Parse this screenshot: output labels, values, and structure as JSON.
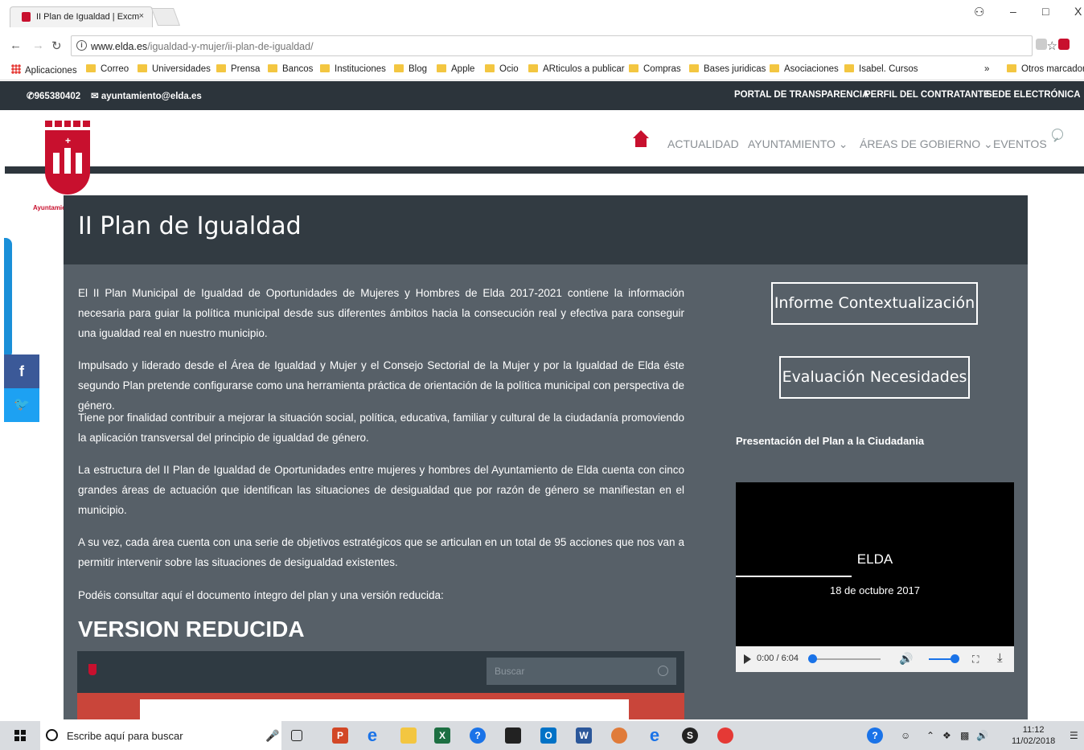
{
  "browser": {
    "tab_title": "II Plan de Igualdad | Excm",
    "tab_close": "×",
    "url_host": "www.elda.es",
    "url_path": "/igualdad-y-mujer/ii-plan-de-igualdad/",
    "window_minimize": "–",
    "window_maximize": "□",
    "window_close": "X"
  },
  "bookmarks": {
    "items": [
      "Aplicaciones",
      "Correo",
      "Universidades",
      "Prensa",
      "Bancos",
      "Instituciones",
      "Blog",
      "Apple",
      "Ocio",
      "ARticulos a publicar",
      "Compras",
      "Bases juridicas",
      "Asociaciones",
      "Isabel. Cursos"
    ],
    "overflow": "»",
    "other": "Otros marcadores"
  },
  "site_top": {
    "phone": "965380402",
    "email": "ayuntamiento@elda.es",
    "links": [
      "PORTAL DE TRANSPARENCIA",
      "PERFIL DEL CONTRATANTE",
      "SEDE ELECTRÓNICA"
    ]
  },
  "header": {
    "logo_text": "Ayuntamiento de Elda",
    "nav": [
      "ACTUALIDAD",
      "AYUNTAMIENTO ⌄",
      "ÁREAS DE GOBIERNO ⌄",
      "EVENTOS"
    ]
  },
  "page": {
    "title": "II Plan de Igualdad",
    "paragraphs": [
      "El II Plan Municipal de Igualdad de Oportunidades de Mujeres y Hombres de Elda 2017-2021 contiene la información necesaria para guiar la política municipal desde sus diferentes ámbitos hacia la consecución real y efectiva para conseguir una igualdad real en nuestro municipio.",
      "Impulsado y liderado desde el Área de Igualdad y Mujer y el Consejo Sectorial de la Mujer y por la Igualdad de Elda  éste segundo Plan pretende configurarse como una herramienta práctica de orientación de la política municipal con perspectiva de género.",
      "Tiene por finalidad contribuir a mejorar la situación social, política, educativa, familiar y cultural de la ciudadanía promoviendo la aplicación transversal del principio de igualdad de género.",
      "La estructura del II Plan de Igualdad de Oportunidades entre mujeres y hombres del Ayuntamiento de Elda cuenta con cinco grandes áreas de actuación que identifican las situaciones de desigualdad que por razón de género se manifiestan en el municipio.",
      "A su vez, cada área cuenta con una serie de objetivos estratégicos que se articulan en un total de 95 acciones que nos van a permitir intervenir sobre las situaciones de desigualdad existentes.",
      "Podéis consultar aquí el documento íntegro del plan y una versión reducida:"
    ],
    "section_heading": "VERSION REDUCIDA",
    "viewer_search_placeholder": "Buscar"
  },
  "sidebar": {
    "button1": "Informe Contextualización",
    "button2": "Evaluación Necesidades",
    "video_caption": "Presentación del Plan a la Ciudadania",
    "video_title": "ELDA",
    "video_date": "18 de octubre 2017",
    "video_time": "0:00 / 6:04"
  },
  "share": {
    "facebook": "f",
    "twitter": "t"
  },
  "taskbar": {
    "search_placeholder": "Escribe aquí para buscar",
    "time": "11:12",
    "date": "11/02/2018"
  }
}
